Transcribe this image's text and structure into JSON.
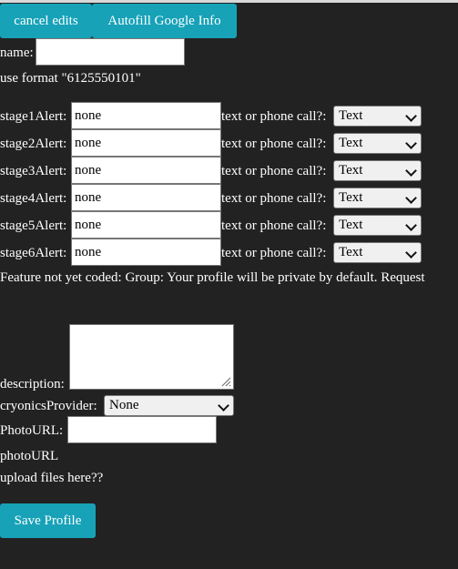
{
  "toolbar": {
    "cancel_label": "cancel edits",
    "autofill_label": "Autofill Google Info"
  },
  "name": {
    "label": "name:",
    "value": ""
  },
  "format_hint": "use format \"6125550101\"",
  "alerts": [
    {
      "label": "stage1Alert:",
      "value": "none",
      "mode_label": "text or phone call?:",
      "mode": "Text"
    },
    {
      "label": "stage2Alert:",
      "value": "none",
      "mode_label": "text or phone call?:",
      "mode": "Text"
    },
    {
      "label": "stage3Alert:",
      "value": "none",
      "mode_label": "text or phone call?:",
      "mode": "Text"
    },
    {
      "label": "stage4Alert:",
      "value": "none",
      "mode_label": "text or phone call?:",
      "mode": "Text"
    },
    {
      "label": "stage5Alert:",
      "value": "none",
      "mode_label": "text or phone call?:",
      "mode": "Text"
    },
    {
      "label": "stage6Alert:",
      "value": "none",
      "mode_label": "text or phone call?:",
      "mode": "Text"
    }
  ],
  "group_note": "Feature not yet coded: Group: Your profile will be private by default. Request",
  "description": {
    "label": "description:",
    "value": ""
  },
  "cryonics": {
    "label": "cryonicsProvider:",
    "selected": "None"
  },
  "photo": {
    "label": "PhotoURL:",
    "value": "",
    "caption": "photoURL",
    "upload_hint": "upload files here??"
  },
  "save_label": "Save Profile",
  "colors": {
    "background": "#222222",
    "button": "#17a2b8"
  }
}
